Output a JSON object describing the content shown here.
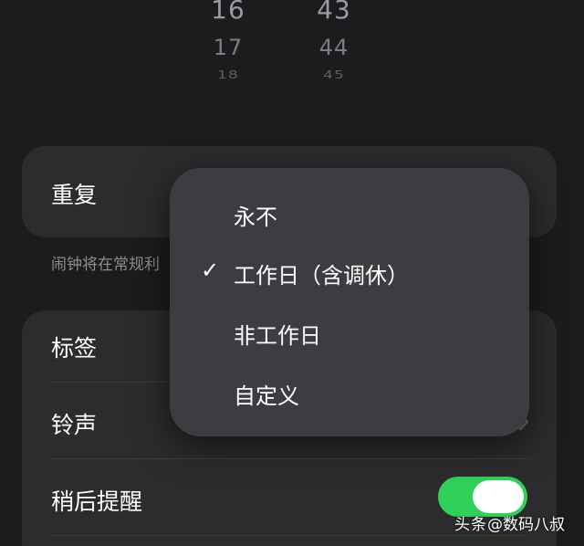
{
  "time_picker": {
    "hours": [
      "16",
      "17",
      "18"
    ],
    "minutes": [
      "43",
      "44",
      "45"
    ]
  },
  "repeat": {
    "label": "重复"
  },
  "note": {
    "text": "闹钟将在常规利"
  },
  "options": {
    "label_row": "标签",
    "ringtone_row": "铃声",
    "snooze_row": "稍后提醒",
    "snooze_on": true
  },
  "repeat_menu": {
    "items": [
      {
        "label": "永不",
        "checked": false
      },
      {
        "label": "工作日（含调休）",
        "checked": true
      },
      {
        "label": "非工作日",
        "checked": false
      },
      {
        "label": "自定义",
        "checked": false
      }
    ],
    "check_glyph": "✓"
  },
  "watermark": {
    "logo": "头条",
    "handle": "@数码八叔"
  },
  "colors": {
    "background": "#1c1c1e",
    "card": "#2c2c2e",
    "menu": "#3d3d41",
    "toggle_on": "#30d158",
    "secondary_text": "#8e8e93"
  },
  "icons": {
    "checkmark": "checkmark-icon",
    "chevron": "chevron-right-icon"
  }
}
